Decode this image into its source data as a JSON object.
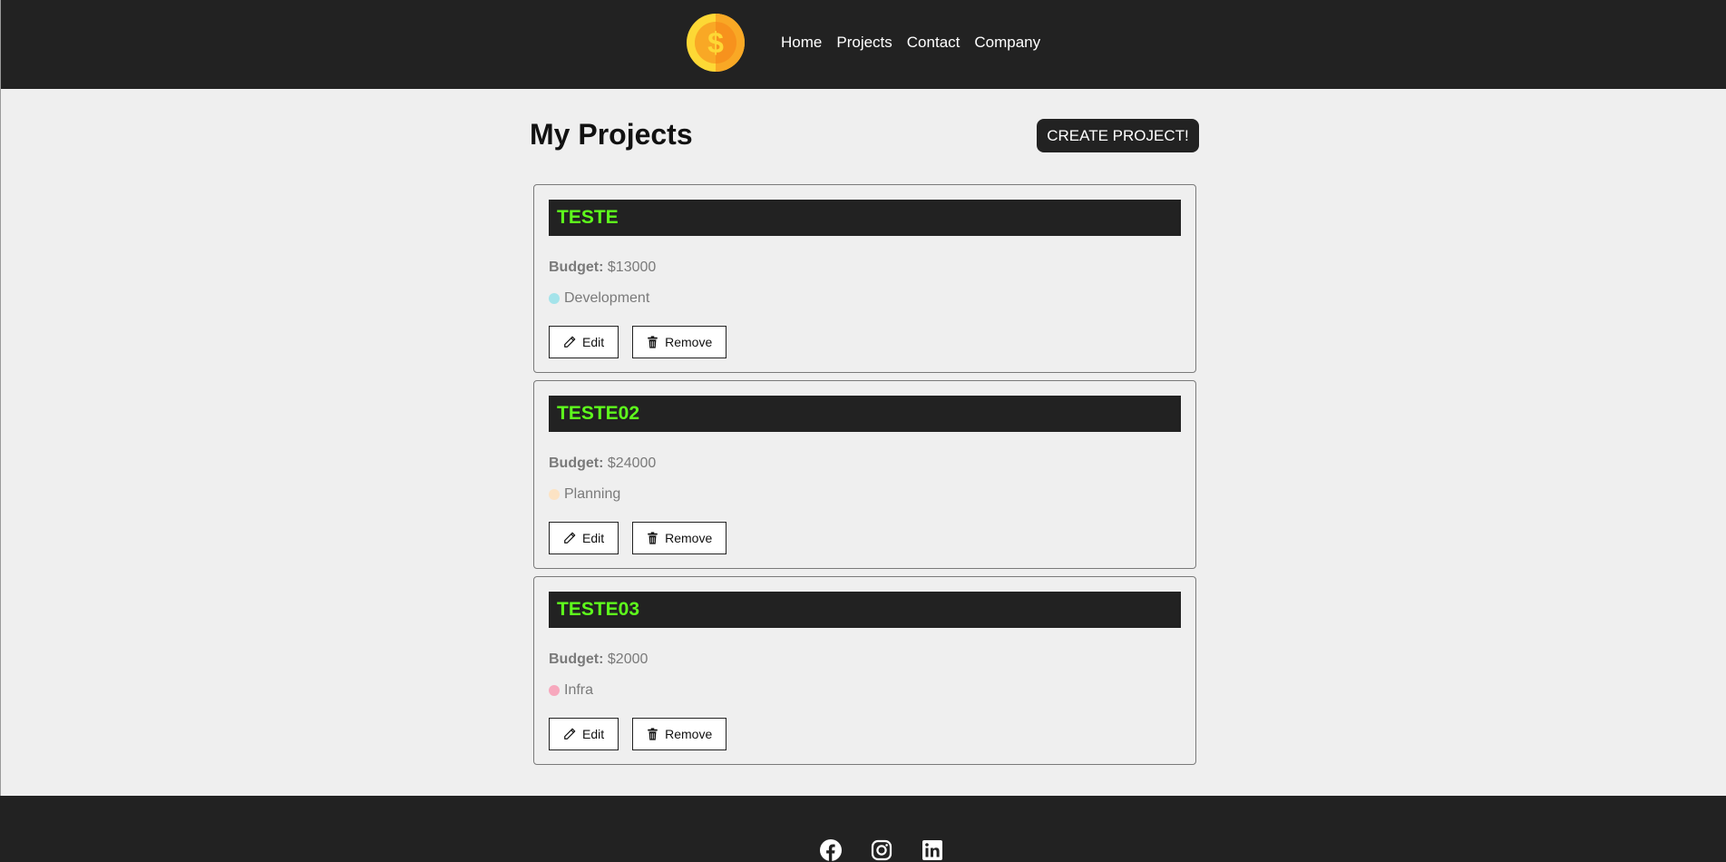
{
  "navbar": {
    "logo_icon": "dollar-coin-icon",
    "links": [
      {
        "label": "Home"
      },
      {
        "label": "Projects"
      },
      {
        "label": "Contact"
      },
      {
        "label": "Company"
      }
    ]
  },
  "page": {
    "title": "My Projects",
    "create_label": "CREATE PROJECT!"
  },
  "projects": [
    {
      "name": "TESTE",
      "budget_label": "Budget:",
      "budget": "$13000",
      "category": "Development",
      "category_color": "#a4e3ea",
      "edit_label": "Edit",
      "remove_label": "Remove"
    },
    {
      "name": "TESTE02",
      "budget_label": "Budget:",
      "budget": "$24000",
      "category": "Planning",
      "category_color": "#fce3c4",
      "edit_label": "Edit",
      "remove_label": "Remove"
    },
    {
      "name": "TESTE03",
      "budget_label": "Budget:",
      "budget": "$2000",
      "category": "Infra",
      "category_color": "#f7a8bd",
      "edit_label": "Edit",
      "remove_label": "Remove"
    }
  ],
  "footer": {
    "icons": [
      "facebook-icon",
      "instagram-icon",
      "linkedin-icon"
    ]
  },
  "colors": {
    "dark": "#222222",
    "accent": "#5efc1c",
    "coin": "#fbc02d"
  }
}
